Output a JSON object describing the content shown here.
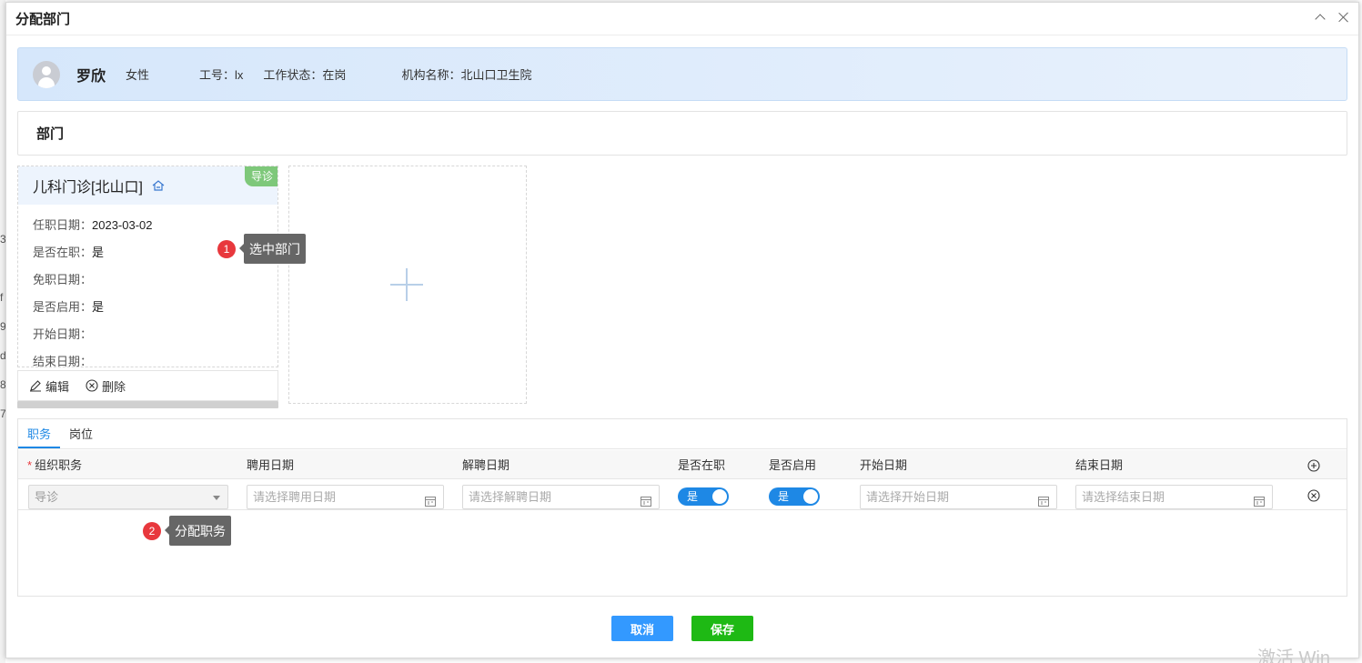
{
  "background": {
    "edge_chars": [
      "3",
      "f",
      "9",
      "d",
      "8",
      "7"
    ]
  },
  "dialog": {
    "title": "分配部门"
  },
  "user": {
    "name": "罗欣",
    "gender": "女性",
    "employee_no": "工号：lx",
    "work_status": "工作状态：在岗",
    "org_name": "机构名称：北山口卫生院"
  },
  "section": {
    "title": "部门"
  },
  "dept_card": {
    "title": "儿科门诊[北山口]",
    "badge": "导诊",
    "rows": [
      {
        "label": "任职日期：",
        "value": "2023-03-02"
      },
      {
        "label": "是否在职：",
        "value": "是"
      },
      {
        "label": "免职日期：",
        "value": ""
      },
      {
        "label": "是否启用：",
        "value": "是"
      },
      {
        "label": "开始日期：",
        "value": ""
      },
      {
        "label": "结束日期：",
        "value": ""
      }
    ],
    "edit_label": "编辑",
    "delete_label": "删除"
  },
  "tooltips": [
    {
      "num": "1",
      "text": "选中部门"
    },
    {
      "num": "2",
      "text": "分配职务"
    }
  ],
  "tabs": [
    "职务",
    "岗位"
  ],
  "grid": {
    "headers": {
      "org_position": "组织职务",
      "hire_date": "聘用日期",
      "dismiss_date": "解聘日期",
      "on_duty": "是否在职",
      "enabled": "是否启用",
      "start_date": "开始日期",
      "end_date": "结束日期"
    },
    "row": {
      "org_position": "导诊",
      "hire_date_placeholder": "请选择聘用日期",
      "dismiss_date_placeholder": "请选择解聘日期",
      "on_duty": "是",
      "enabled": "是",
      "start_date_placeholder": "请选择开始日期",
      "end_date_placeholder": "请选择结束日期"
    }
  },
  "buttons": {
    "cancel": "取消",
    "save": "保存"
  },
  "watermark": "激活 Win",
  "colors": {
    "primary": "#3399ff",
    "save": "#1eb914",
    "accent_tab": "#1e88e5",
    "badge": "#7ec87a",
    "tip_num": "#e8383d"
  }
}
